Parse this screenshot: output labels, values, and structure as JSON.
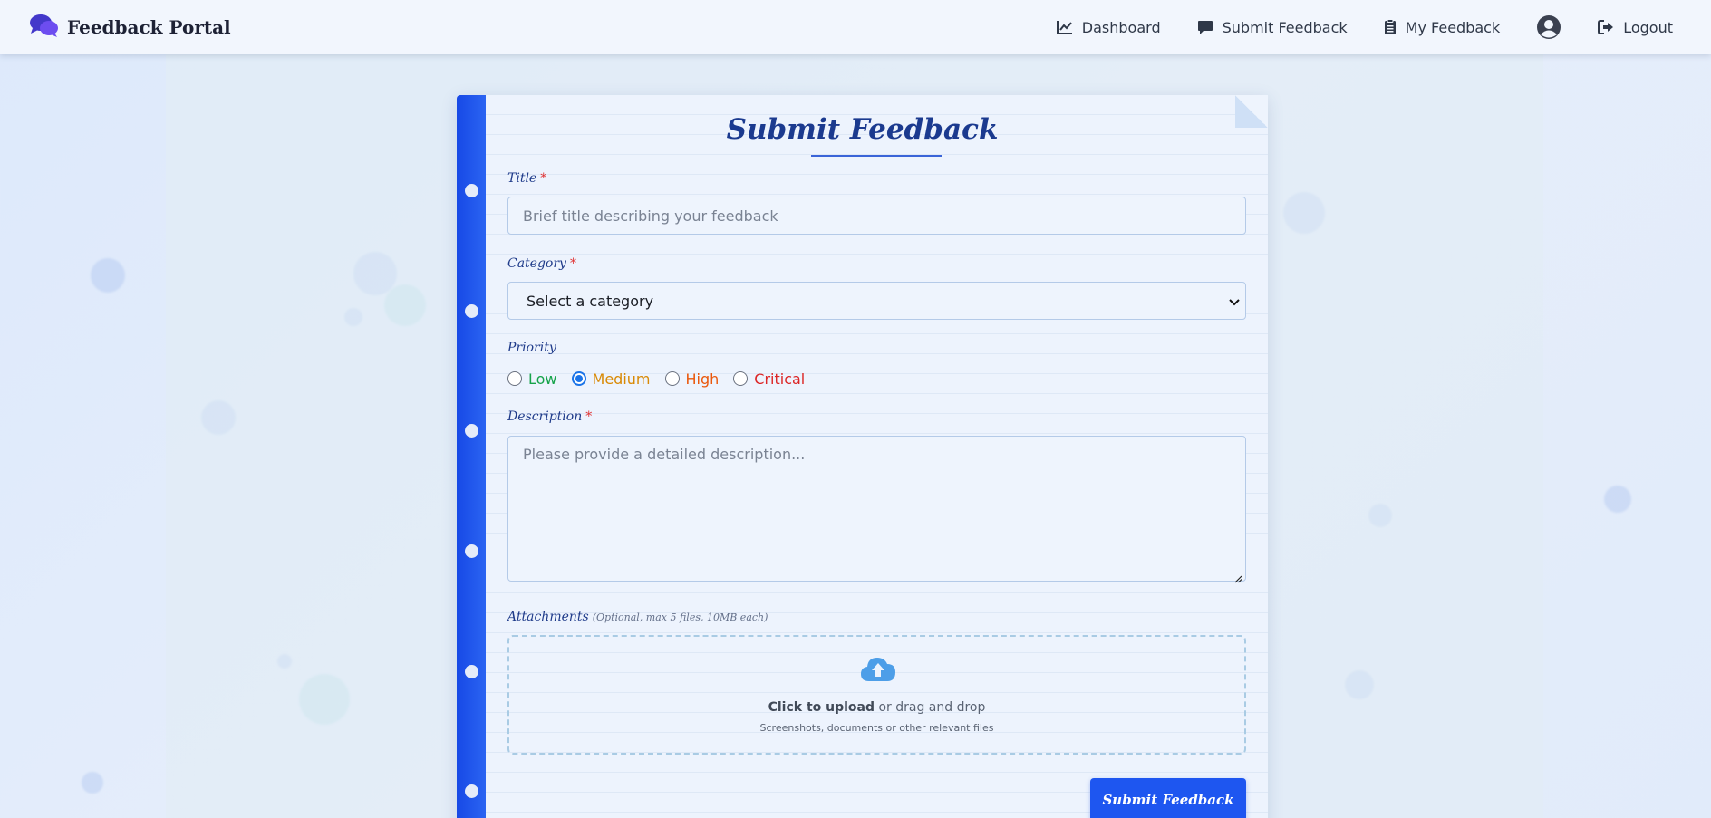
{
  "app": {
    "brand": "Feedback Portal",
    "brand_icon": "comments-icon"
  },
  "nav": {
    "items": [
      {
        "label": "Dashboard",
        "icon": "chart-line-icon"
      },
      {
        "label": "Submit Feedback",
        "icon": "comment-icon"
      },
      {
        "label": "My Feedback",
        "icon": "clipboard-list-icon"
      },
      {
        "label": "",
        "icon": "user-circle-icon"
      },
      {
        "label": "Logout",
        "icon": "sign-out-icon"
      }
    ]
  },
  "form": {
    "title": "Submit Feedback",
    "title_field": {
      "label": "Title",
      "required_mark": "*",
      "placeholder": "Brief title describing your feedback",
      "value": ""
    },
    "category_field": {
      "label": "Category",
      "required_mark": "*",
      "selected": "Select a category"
    },
    "priority_field": {
      "label": "Priority",
      "options": [
        {
          "label": "Low",
          "color": "#16a34a",
          "checked": false
        },
        {
          "label": "Medium",
          "color": "#d98a06",
          "checked": true
        },
        {
          "label": "High",
          "color": "#ea580c",
          "checked": false
        },
        {
          "label": "Critical",
          "color": "#dc2626",
          "checked": false
        }
      ]
    },
    "description_field": {
      "label": "Description",
      "required_mark": "*",
      "placeholder": "Please provide a detailed description...",
      "value": ""
    },
    "attachments_field": {
      "label": "Attachments",
      "hint": "(Optional, max 5 files, 10MB each)",
      "upload_strong": "Click to upload",
      "upload_rest": " or drag and drop",
      "upload_sub": "Screenshots, documents or other relevant files",
      "icon": "cloud-upload-icon"
    },
    "submit_label": "Submit Feedback"
  },
  "colors": {
    "accent": "#1e56f0",
    "spine": "#1749e6",
    "heading": "#1b3a8f",
    "required": "#e03131"
  }
}
